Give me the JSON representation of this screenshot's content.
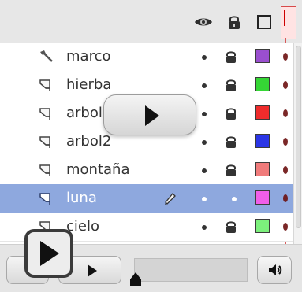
{
  "header": {
    "icons": [
      "eye-icon",
      "lock-icon",
      "outline-icon"
    ],
    "accent": "#d64a4a"
  },
  "layers": [
    {
      "name": "marco",
      "icon": "hammer-icon",
      "color": "#9a4fcf",
      "selected": false
    },
    {
      "name": "hierba",
      "icon": "layer-icon",
      "color": "#35d635",
      "selected": false
    },
    {
      "name": "arbol",
      "icon": "layer-icon",
      "color": "#ef2c2c",
      "selected": false
    },
    {
      "name": "arbol2",
      "icon": "layer-icon",
      "color": "#2b36e6",
      "selected": false
    },
    {
      "name": "montaña",
      "icon": "layer-icon",
      "color": "#f07b7b",
      "selected": false
    },
    {
      "name": "luna",
      "icon": "layer-icon",
      "color": "#f05ee8",
      "selected": true
    },
    {
      "name": "cielo",
      "icon": "layer-icon",
      "color": "#7cf07c",
      "selected": false
    }
  ],
  "overlays": {
    "center_play_icon": "play-icon",
    "corner_play_icon": "play-icon"
  },
  "controls": {
    "play_icon": "play-icon",
    "volume_icon": "speaker-icon"
  }
}
